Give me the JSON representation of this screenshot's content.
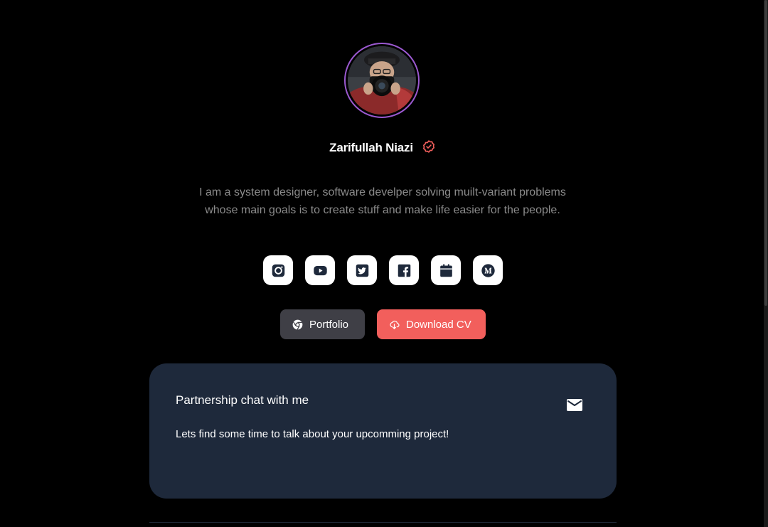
{
  "profile": {
    "name": "Zarifullah Niazi",
    "bio": "I am a system designer, software develper solving muilt-variant problems whose main goals is to create stuff and make life easier for the people."
  },
  "socials": [
    {
      "icon": "instagram-icon"
    },
    {
      "icon": "youtube-icon"
    },
    {
      "icon": "twitter-icon"
    },
    {
      "icon": "facebook-icon"
    },
    {
      "icon": "calendar-icon"
    },
    {
      "icon": "medium-icon"
    }
  ],
  "actions": {
    "portfolio_label": "Portfolio",
    "download_label": "Download CV"
  },
  "card": {
    "title": "Partnership chat with me",
    "text": "Lets find some time to talk about your upcomming project!"
  },
  "colors": {
    "background": "#000000",
    "accent": "#f25f5c",
    "card": "#1e293b",
    "avatar_ring": "#9b59d0",
    "portfolio_button": "#3f3f46",
    "bio_text": "#8b8b8b"
  }
}
